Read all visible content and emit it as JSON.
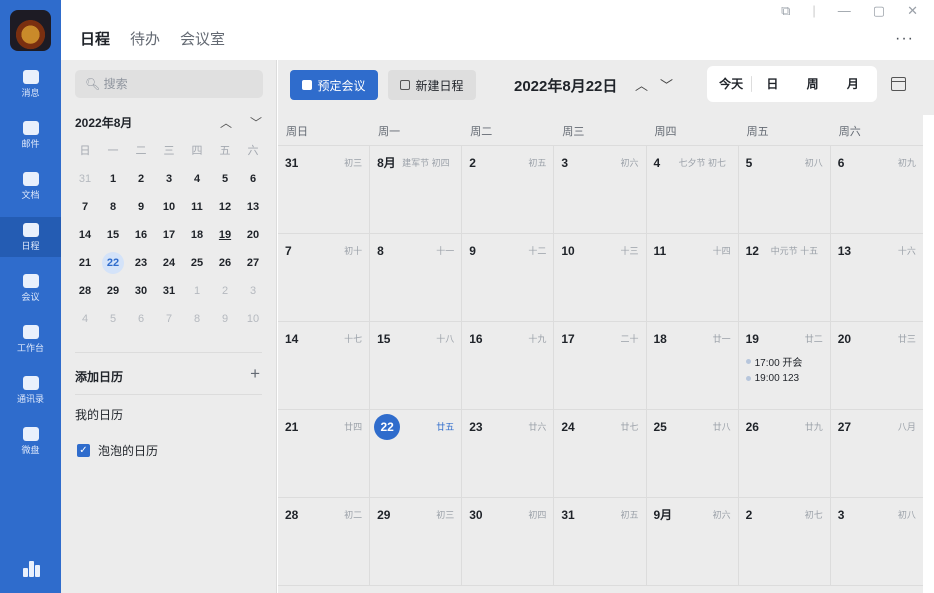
{
  "nav": {
    "items": [
      {
        "label": "消息",
        "icon": "chat-icon"
      },
      {
        "label": "邮件",
        "icon": "mail-icon"
      },
      {
        "label": "文档",
        "icon": "document-icon"
      },
      {
        "label": "日程",
        "icon": "calendar-icon"
      },
      {
        "label": "会议",
        "icon": "meeting-icon"
      },
      {
        "label": "工作台",
        "icon": "workspace-icon"
      },
      {
        "label": "通讯录",
        "icon": "contacts-icon"
      },
      {
        "label": "微盘",
        "icon": "drive-icon"
      }
    ],
    "active_index": 3
  },
  "top_tabs": [
    "日程",
    "待办",
    "会议室"
  ],
  "window_controls": {
    "more": "···"
  },
  "sidebar": {
    "search_placeholder": "搜索",
    "mini_month_title": "2022年8月",
    "mini_weekday_headers": [
      "日",
      "一",
      "二",
      "三",
      "四",
      "五",
      "六"
    ],
    "mini_days": [
      [
        {
          "d": "31",
          "dim": true
        },
        {
          "d": "1"
        },
        {
          "d": "2"
        },
        {
          "d": "3"
        },
        {
          "d": "4"
        },
        {
          "d": "5"
        },
        {
          "d": "6"
        }
      ],
      [
        {
          "d": "7"
        },
        {
          "d": "8"
        },
        {
          "d": "9"
        },
        {
          "d": "10"
        },
        {
          "d": "11"
        },
        {
          "d": "12"
        },
        {
          "d": "13"
        }
      ],
      [
        {
          "d": "14"
        },
        {
          "d": "15"
        },
        {
          "d": "16"
        },
        {
          "d": "17"
        },
        {
          "d": "18"
        },
        {
          "d": "19",
          "underline": true
        },
        {
          "d": "20"
        }
      ],
      [
        {
          "d": "21"
        },
        {
          "d": "22",
          "today": true
        },
        {
          "d": "23"
        },
        {
          "d": "24"
        },
        {
          "d": "25"
        },
        {
          "d": "26"
        },
        {
          "d": "27"
        }
      ],
      [
        {
          "d": "28"
        },
        {
          "d": "29"
        },
        {
          "d": "30"
        },
        {
          "d": "31"
        },
        {
          "d": "1",
          "dim": true
        },
        {
          "d": "2",
          "dim": true
        },
        {
          "d": "3",
          "dim": true
        }
      ],
      [
        {
          "d": "4",
          "dim": true
        },
        {
          "d": "5",
          "dim": true
        },
        {
          "d": "6",
          "dim": true
        },
        {
          "d": "7",
          "dim": true
        },
        {
          "d": "8",
          "dim": true
        },
        {
          "d": "9",
          "dim": true
        },
        {
          "d": "10",
          "dim": true
        }
      ]
    ],
    "add_calendar_label": "添加日历",
    "add_calendar_plus": "+",
    "my_calendars_label": "我的日历",
    "calendars": [
      {
        "name": "泡泡的日历",
        "checked": true
      }
    ]
  },
  "toolbar": {
    "book_meeting_label": "预定会议",
    "new_event_label": "新建日程",
    "current_date": "2022年8月22日",
    "prev_glyph": "^",
    "next_glyph": "v",
    "views": [
      "今天",
      "日",
      "周",
      "月"
    ],
    "active_view": "月"
  },
  "calendar": {
    "weekdays": [
      "周日",
      "周一",
      "周二",
      "周三",
      "周四",
      "周五",
      "周六"
    ],
    "weeks": [
      [
        {
          "d": "31",
          "l": "初三"
        },
        {
          "d": "8月",
          "l": "建军节 初四",
          "lleft": true
        },
        {
          "d": "2",
          "l": "初五"
        },
        {
          "d": "3",
          "l": "初六"
        },
        {
          "d": "4",
          "l": "七夕节 初七",
          "lleft": true
        },
        {
          "d": "5",
          "l": "初八"
        },
        {
          "d": "6",
          "l": "初九"
        }
      ],
      [
        {
          "d": "7",
          "l": "初十"
        },
        {
          "d": "8",
          "l": "十一"
        },
        {
          "d": "9",
          "l": "十二"
        },
        {
          "d": "10",
          "l": "十三"
        },
        {
          "d": "11",
          "l": "十四"
        },
        {
          "d": "12",
          "l": "中元节 十五",
          "lleft": true
        },
        {
          "d": "13",
          "l": "十六"
        }
      ],
      [
        {
          "d": "14",
          "l": "十七"
        },
        {
          "d": "15",
          "l": "十八"
        },
        {
          "d": "16",
          "l": "十九"
        },
        {
          "d": "17",
          "l": "二十"
        },
        {
          "d": "18",
          "l": "廿一"
        },
        {
          "d": "19",
          "l": "廿二",
          "events": [
            "17:00 开会",
            "19:00 123"
          ]
        },
        {
          "d": "20",
          "l": "廿三"
        }
      ],
      [
        {
          "d": "21",
          "l": "廿四"
        },
        {
          "d": "22",
          "l": "廿五",
          "today": true
        },
        {
          "d": "23",
          "l": "廿六"
        },
        {
          "d": "24",
          "l": "廿七"
        },
        {
          "d": "25",
          "l": "廿八"
        },
        {
          "d": "26",
          "l": "廿九"
        },
        {
          "d": "27",
          "l": "八月"
        }
      ],
      [
        {
          "d": "28",
          "l": "初二"
        },
        {
          "d": "29",
          "l": "初三"
        },
        {
          "d": "30",
          "l": "初四"
        },
        {
          "d": "31",
          "l": "初五"
        },
        {
          "d": "9月",
          "l": "初六"
        },
        {
          "d": "2",
          "l": "初七"
        },
        {
          "d": "3",
          "l": "初八"
        }
      ]
    ]
  },
  "colors": {
    "accent": "#2f6ccc",
    "rail": "#2f6ccc"
  }
}
